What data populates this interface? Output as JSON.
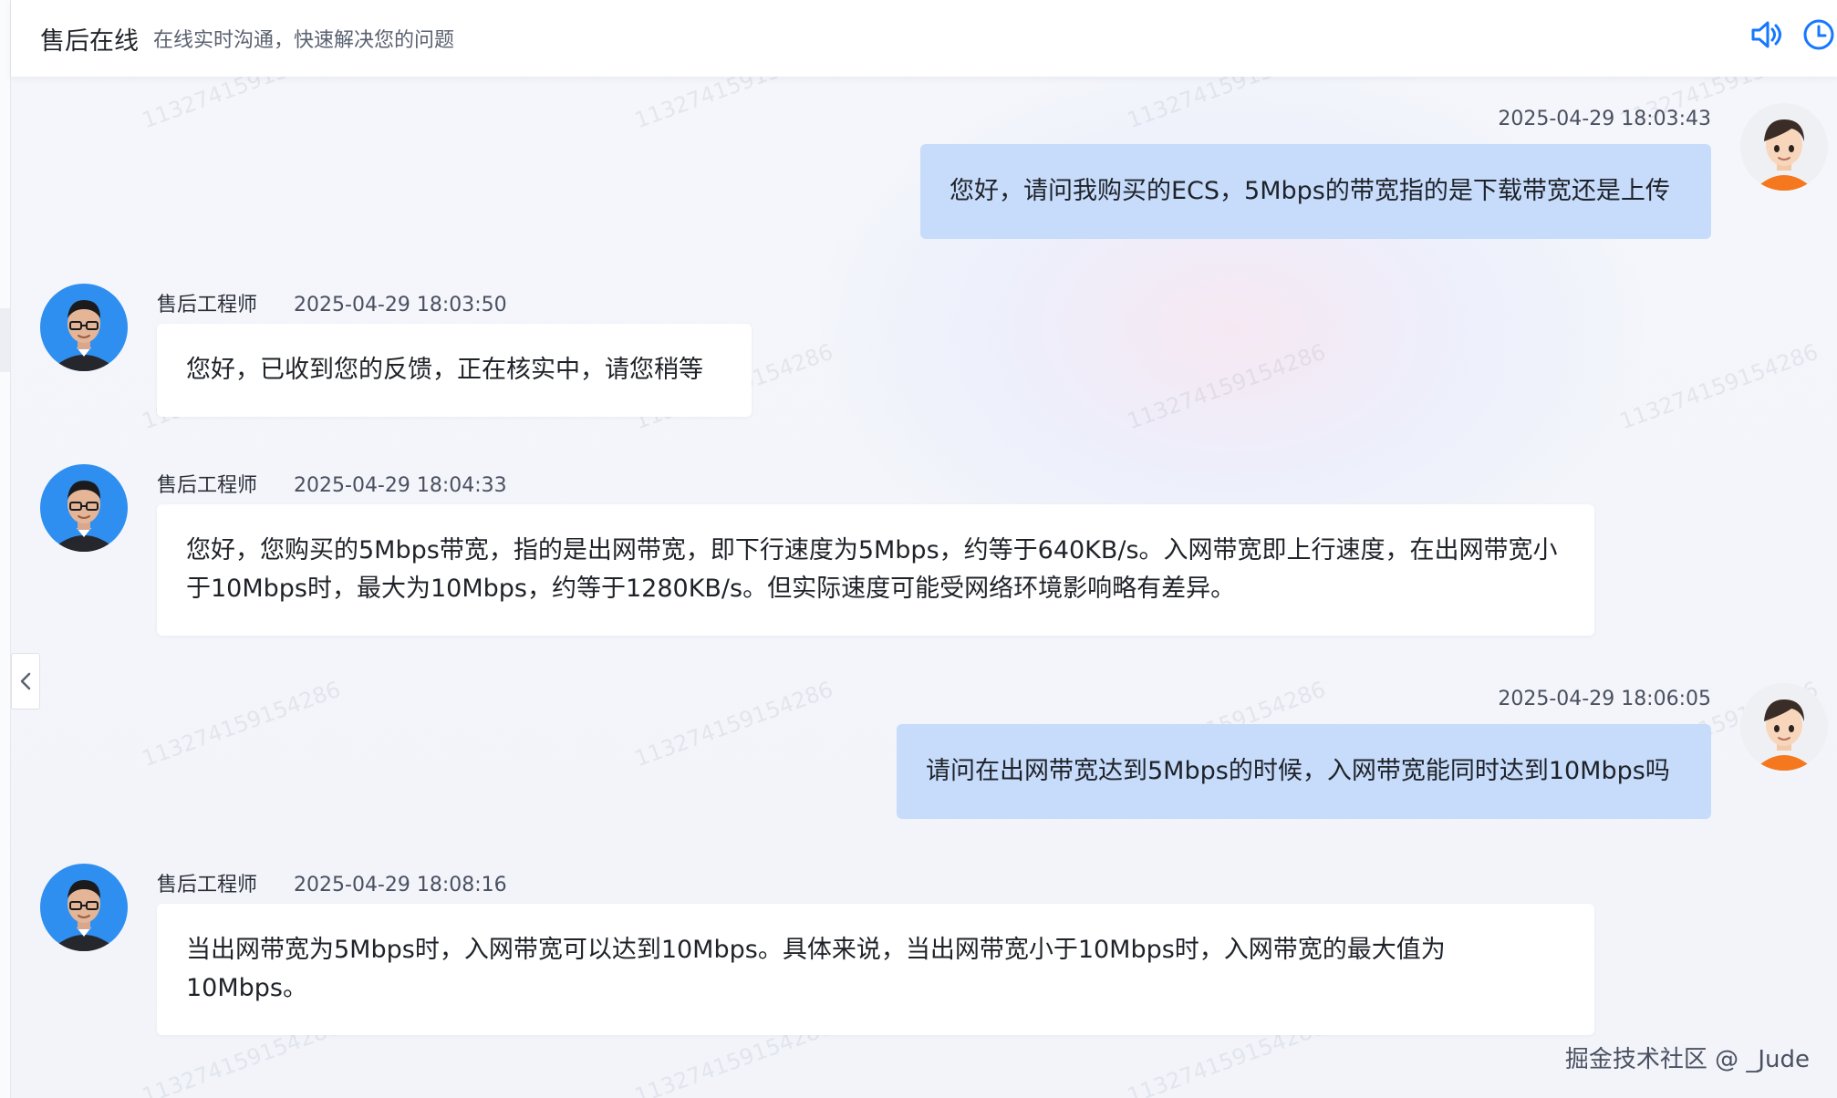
{
  "header": {
    "title": "售后在线",
    "subtitle": "在线实时沟通，快速解决您的问题",
    "icons": [
      "speaker-icon",
      "clock-icon"
    ]
  },
  "watermark_text": "113274159154286",
  "messages": [
    {
      "role": "user",
      "time": "2025-04-29 18:03:43",
      "text": "您好，请问我购买的ECS，5Mbps的带宽指的是下载带宽还是上传"
    },
    {
      "role": "agent",
      "name": "售后工程师",
      "time": "2025-04-29 18:03:50",
      "text": "您好，已收到您的反馈，正在核实中，请您稍等"
    },
    {
      "role": "agent",
      "name": "售后工程师",
      "time": "2025-04-29 18:04:33",
      "text": "您好，您购买的5Mbps带宽，指的是出网带宽，即下行速度为5Mbps，约等于640KB/s。入网带宽即上行速度，在出网带宽小于10Mbps时，最大为10Mbps，约等于1280KB/s。但实际速度可能受网络环境影响略有差异。"
    },
    {
      "role": "user",
      "time": "2025-04-29 18:06:05",
      "text": "请问在出网带宽达到5Mbps的时候，入网带宽能同时达到10Mbps吗"
    },
    {
      "role": "agent",
      "name": "售后工程师",
      "time": "2025-04-29 18:08:16",
      "text": "当出网带宽为5Mbps时，入网带宽可以达到10Mbps。具体来说，当出网带宽小于10Mbps时，入网带宽的最大值为10Mbps。"
    }
  ],
  "footer": "掘金技术社区 @ _Jude",
  "colors": {
    "user_bubble": "#c7dbfb",
    "agent_bubble": "#ffffff",
    "accent": "#1677ff"
  }
}
